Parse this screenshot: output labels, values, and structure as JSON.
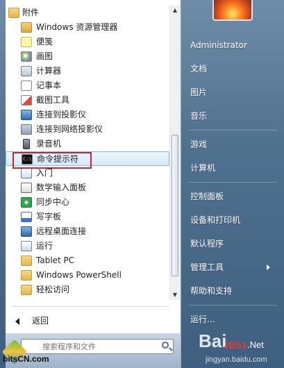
{
  "programs": {
    "items": [
      {
        "label": "附件",
        "icon": "folder-icon",
        "top": true
      },
      {
        "label": "Windows 资源管理器",
        "icon": "explorer-icon"
      },
      {
        "label": "便笺",
        "icon": "sticky-notes-icon"
      },
      {
        "label": "画图",
        "icon": "paint-icon"
      },
      {
        "label": "计算器",
        "icon": "calculator-icon"
      },
      {
        "label": "记事本",
        "icon": "notepad-icon"
      },
      {
        "label": "截图工具",
        "icon": "snipping-tool-icon"
      },
      {
        "label": "连接到投影仪",
        "icon": "projector-icon"
      },
      {
        "label": "连接到网络投影仪",
        "icon": "network-projector-icon"
      },
      {
        "label": "录音机",
        "icon": "microphone-icon"
      },
      {
        "label": "命令提示符",
        "icon": "command-prompt-icon",
        "highlighted": true
      },
      {
        "label": "入门",
        "icon": "getting-started-icon"
      },
      {
        "label": "数学输入面板",
        "icon": "math-input-icon"
      },
      {
        "label": "同步中心",
        "icon": "sync-center-icon"
      },
      {
        "label": "写字板",
        "icon": "wordpad-icon"
      },
      {
        "label": "远程桌面连接",
        "icon": "remote-desktop-icon"
      },
      {
        "label": "运行",
        "icon": "run-icon"
      },
      {
        "label": "Tablet PC",
        "icon": "folder-icon"
      },
      {
        "label": "Windows PowerShell",
        "icon": "folder-icon"
      },
      {
        "label": "轻松访问",
        "icon": "folder-icon"
      }
    ]
  },
  "cmd_icon_text": "C:\\",
  "back_label": "返回",
  "search": {
    "placeholder": "搜索程序和文件"
  },
  "right_menu": {
    "user": "Administrator",
    "documents": "文档",
    "pictures": "图片",
    "music": "音乐",
    "games": "游戏",
    "computer": "计算机",
    "control_panel": "控制面板",
    "devices": "设备和打印机",
    "default_programs": "默认程序",
    "admin_tools": "管理工具",
    "help": "帮助和支持",
    "run": "运行..."
  },
  "watermarks": {
    "bitscn": "bitsCN.com",
    "baidu": "Bai",
    "jb": "JB51",
    "jbnet": ".Net",
    "url": "jingyan.baidu.com"
  },
  "colors": {
    "highlight_border": "#8fb6e3",
    "annotation_red": "#c1272d"
  }
}
